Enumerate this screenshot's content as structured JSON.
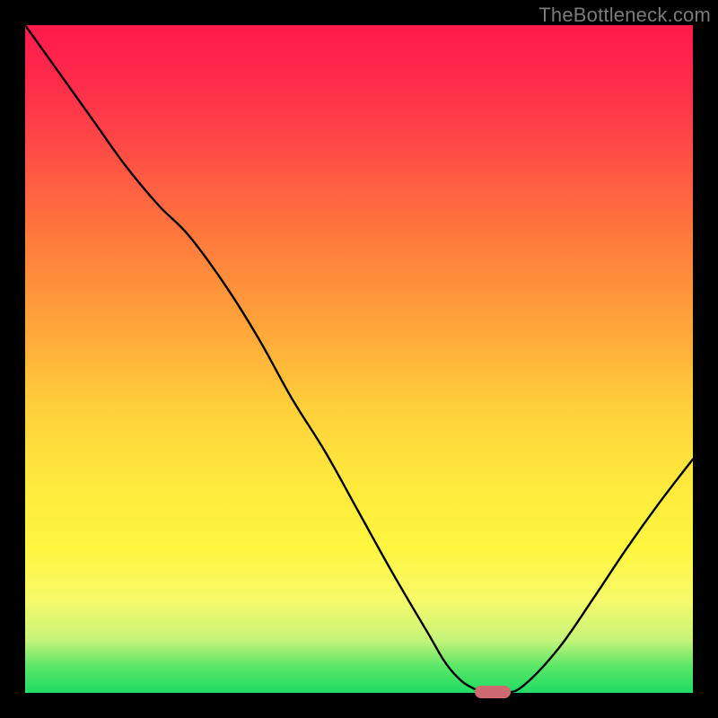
{
  "watermark": "TheBottleneck.com",
  "colors": {
    "frame": "#000000",
    "curve": "#000000",
    "marker": "#cd6a6f",
    "gradient_top": "#ff1a4d",
    "gradient_bottom": "#1fdc64"
  },
  "chart_data": {
    "type": "line",
    "title": "",
    "xlabel": "",
    "ylabel": "",
    "xlim": [
      0,
      1
    ],
    "ylim": [
      0,
      1
    ],
    "x": [
      0.0,
      0.05,
      0.1,
      0.15,
      0.2,
      0.245,
      0.3,
      0.35,
      0.4,
      0.45,
      0.5,
      0.55,
      0.6,
      0.637,
      0.675,
      0.72,
      0.75,
      0.8,
      0.85,
      0.9,
      0.95,
      1.0
    ],
    "y": [
      1.0,
      0.93,
      0.86,
      0.79,
      0.73,
      0.685,
      0.61,
      0.53,
      0.44,
      0.36,
      0.27,
      0.18,
      0.095,
      0.035,
      0.005,
      0.0,
      0.014,
      0.068,
      0.14,
      0.215,
      0.285,
      0.35
    ],
    "annotations": [
      {
        "kind": "marker",
        "shape": "pill",
        "x": 0.7,
        "y": 0.002,
        "color": "#cd6a6f"
      }
    ],
    "notes": "Values estimated from pixel positions; chart has no visible axes, ticks, or labels. y=0 at bottom, y=1 at top of gradient area."
  }
}
